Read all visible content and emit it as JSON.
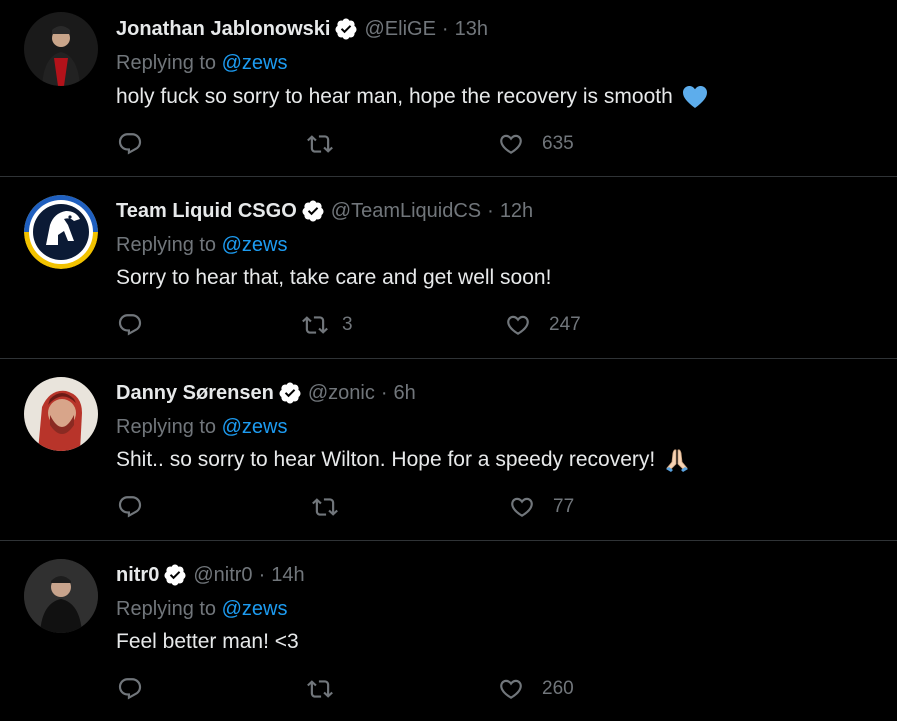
{
  "tweets": [
    {
      "name": "Jonathan Jablonowski",
      "handle": "@EliGE",
      "separator": "·",
      "time": "13h",
      "reply_prefix": "Replying to ",
      "reply_to": "@zews",
      "text": "holy fuck so sorry to hear man, hope the recovery is smooth",
      "emoji": "blue-heart",
      "reply_count": "",
      "retweet_count": "",
      "like_count": "635"
    },
    {
      "name": "Team Liquid CSGO",
      "handle": "@TeamLiquidCS",
      "separator": "·",
      "time": "12h",
      "reply_prefix": "Replying to ",
      "reply_to": "@zews",
      "text": "Sorry to hear that, take care and get well soon!",
      "emoji": "",
      "reply_count": "",
      "retweet_count": "3",
      "like_count": "247"
    },
    {
      "name": "Danny Sørensen",
      "handle": "@zonic",
      "separator": "·",
      "time": "6h",
      "reply_prefix": "Replying to ",
      "reply_to": "@zews",
      "text": "Shit.. so sorry to hear Wilton. Hope for a speedy recovery!",
      "emoji": "folded-hands",
      "reply_count": "",
      "retweet_count": "",
      "like_count": "77"
    },
    {
      "name": "nitr0",
      "handle": "@nitr0",
      "separator": "·",
      "time": "14h",
      "reply_prefix": "Replying to ",
      "reply_to": "@zews",
      "text": "Feel better man! <3",
      "emoji": "",
      "reply_count": "",
      "retweet_count": "",
      "like_count": "260"
    }
  ],
  "colors": {
    "background": "#000000",
    "text": "#e7e9ea",
    "muted": "#71767b",
    "link": "#1d9bf0",
    "verified": "#ffffff",
    "divider": "#2f3336"
  }
}
